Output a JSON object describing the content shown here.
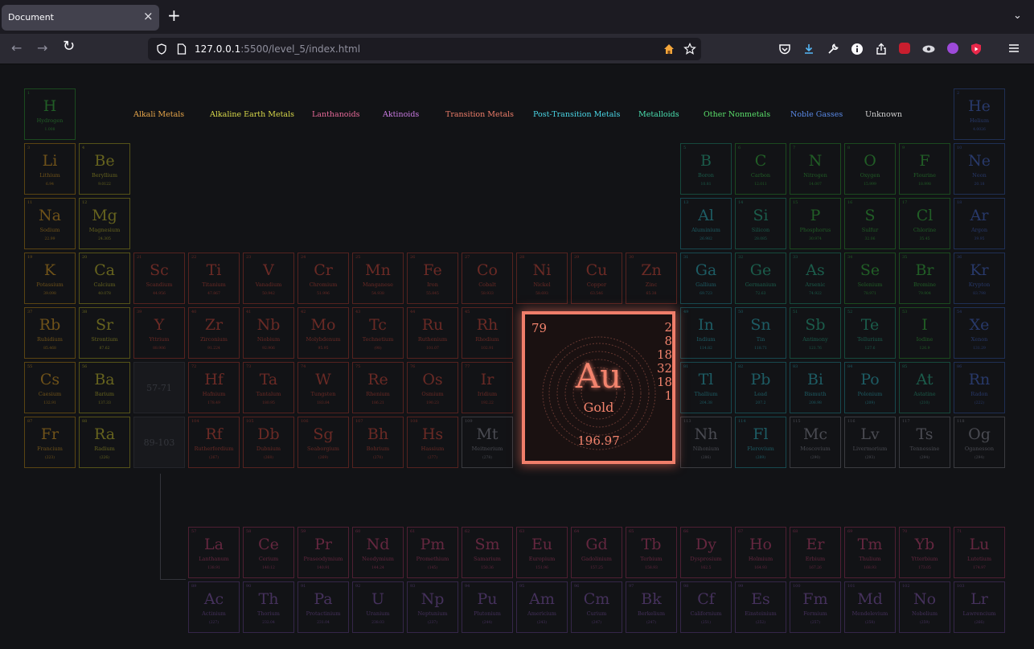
{
  "browser": {
    "tab_title": "Document",
    "tab_close": "×",
    "new_tab": "+",
    "tabs_menu": "⌄",
    "url_host": "127.0.0.1",
    "url_path": ":5500/level_5/index.html",
    "nav": {
      "back": "←",
      "forward": "→",
      "reload": "↻"
    }
  },
  "legend": [
    {
      "label": "Alkali Metals",
      "color": "#e8a64a"
    },
    {
      "label": "Alkaline Earth Metals",
      "color": "#d9d94a"
    },
    {
      "label": "Lanthanoids",
      "color": "#e86a9a"
    },
    {
      "label": "Aktinoids",
      "color": "#c87ae0"
    },
    {
      "label": "Transition Metals",
      "color": "#f07e6a"
    },
    {
      "label": "Post-Transition Metals",
      "color": "#4ad8e8"
    },
    {
      "label": "Metalloids",
      "color": "#4ae0b0"
    },
    {
      "label": "Other Nonmetals",
      "color": "#5ae06a"
    },
    {
      "label": "Noble Gasses",
      "color": "#5a8ae8"
    },
    {
      "label": "Unknown",
      "color": "#cfcfcf"
    }
  ],
  "categories": {
    "alkali": {
      "border": "#5a4412",
      "text": "#6f5219"
    },
    "alkaline": {
      "border": "#555218",
      "text": "#66631e"
    },
    "transition": {
      "border": "#55221f",
      "text": "#6a2a25"
    },
    "post": {
      "border": "#17484e",
      "text": "#1d5c64"
    },
    "metalloid": {
      "border": "#16493c",
      "text": "#1b5c4b"
    },
    "nonmetal": {
      "border": "#1b4a1f",
      "text": "#215e26"
    },
    "noble": {
      "border": "#1f2f54",
      "text": "#28396a"
    },
    "unknown": {
      "border": "#3a3b40",
      "text": "#4a4b52"
    },
    "lanth": {
      "border": "#4e1f33",
      "text": "#64273f"
    },
    "act": {
      "border": "#352648",
      "text": "#45315c"
    }
  },
  "elements": [
    {
      "n": "1",
      "s": "H",
      "name": "Hydrogen",
      "w": "1.008",
      "c": "nonmetal",
      "r": 1,
      "col": 1
    },
    {
      "n": "2",
      "s": "He",
      "name": "Helium",
      "w": "4.0026",
      "c": "noble",
      "r": 1,
      "col": 18
    },
    {
      "n": "3",
      "s": "Li",
      "name": "Lithium",
      "w": "6.94",
      "c": "alkali",
      "r": 2,
      "col": 1
    },
    {
      "n": "4",
      "s": "Be",
      "name": "Beryllium",
      "w": "9.0122",
      "c": "alkaline",
      "r": 2,
      "col": 2
    },
    {
      "n": "5",
      "s": "B",
      "name": "Boron",
      "w": "10.81",
      "c": "metalloid",
      "r": 2,
      "col": 13
    },
    {
      "n": "6",
      "s": "C",
      "name": "Carbon",
      "w": "12.011",
      "c": "nonmetal",
      "r": 2,
      "col": 14
    },
    {
      "n": "7",
      "s": "N",
      "name": "Nitrogen",
      "w": "14.007",
      "c": "nonmetal",
      "r": 2,
      "col": 15
    },
    {
      "n": "8",
      "s": "O",
      "name": "Oxygen",
      "w": "15.999",
      "c": "nonmetal",
      "r": 2,
      "col": 16
    },
    {
      "n": "9",
      "s": "F",
      "name": "Flourine",
      "w": "18.998",
      "c": "nonmetal",
      "r": 2,
      "col": 17
    },
    {
      "n": "10",
      "s": "Ne",
      "name": "Neon",
      "w": "20.18",
      "c": "noble",
      "r": 2,
      "col": 18
    },
    {
      "n": "11",
      "s": "Na",
      "name": "Sodium",
      "w": "22.99",
      "c": "alkali",
      "r": 3,
      "col": 1
    },
    {
      "n": "12",
      "s": "Mg",
      "name": "Magnesium",
      "w": "24.305",
      "c": "alkaline",
      "r": 3,
      "col": 2
    },
    {
      "n": "13",
      "s": "Al",
      "name": "Aluminium",
      "w": "26.982",
      "c": "post",
      "r": 3,
      "col": 13
    },
    {
      "n": "14",
      "s": "Si",
      "name": "Silicon",
      "w": "28.085",
      "c": "metalloid",
      "r": 3,
      "col": 14
    },
    {
      "n": "15",
      "s": "P",
      "name": "Phosphorus",
      "w": "30.974",
      "c": "nonmetal",
      "r": 3,
      "col": 15
    },
    {
      "n": "16",
      "s": "S",
      "name": "Sulfur",
      "w": "32.06",
      "c": "nonmetal",
      "r": 3,
      "col": 16
    },
    {
      "n": "17",
      "s": "Cl",
      "name": "Chlorine",
      "w": "35.45",
      "c": "nonmetal",
      "r": 3,
      "col": 17
    },
    {
      "n": "18",
      "s": "Ar",
      "name": "Argon",
      "w": "39.95",
      "c": "noble",
      "r": 3,
      "col": 18
    },
    {
      "n": "19",
      "s": "K",
      "name": "Potassium",
      "w": "39.098",
      "c": "alkali",
      "r": 4,
      "col": 1
    },
    {
      "n": "20",
      "s": "Ca",
      "name": "Calcium",
      "w": "40.078",
      "c": "alkaline",
      "r": 4,
      "col": 2
    },
    {
      "n": "21",
      "s": "Sc",
      "name": "Scandium",
      "w": "44.956",
      "c": "transition",
      "r": 4,
      "col": 3
    },
    {
      "n": "22",
      "s": "Ti",
      "name": "Titanium",
      "w": "47.867",
      "c": "transition",
      "r": 4,
      "col": 4
    },
    {
      "n": "23",
      "s": "V",
      "name": "Vanadium",
      "w": "50.942",
      "c": "transition",
      "r": 4,
      "col": 5
    },
    {
      "n": "24",
      "s": "Cr",
      "name": "Chromium",
      "w": "51.996",
      "c": "transition",
      "r": 4,
      "col": 6
    },
    {
      "n": "25",
      "s": "Mn",
      "name": "Manganese",
      "w": "54.938",
      "c": "transition",
      "r": 4,
      "col": 7
    },
    {
      "n": "26",
      "s": "Fe",
      "name": "Iron",
      "w": "55.845",
      "c": "transition",
      "r": 4,
      "col": 8
    },
    {
      "n": "27",
      "s": "Co",
      "name": "Cobalt",
      "w": "58.933",
      "c": "transition",
      "r": 4,
      "col": 9
    },
    {
      "n": "28",
      "s": "Ni",
      "name": "Nickel",
      "w": "58.693",
      "c": "transition",
      "r": 4,
      "col": 10
    },
    {
      "n": "29",
      "s": "Cu",
      "name": "Copper",
      "w": "63.546",
      "c": "transition",
      "r": 4,
      "col": 11
    },
    {
      "n": "30",
      "s": "Zn",
      "name": "Zinc",
      "w": "65.38",
      "c": "transition",
      "r": 4,
      "col": 12
    },
    {
      "n": "31",
      "s": "Ga",
      "name": "Gallium",
      "w": "69.723",
      "c": "post",
      "r": 4,
      "col": 13
    },
    {
      "n": "32",
      "s": "Ge",
      "name": "Germanium",
      "w": "72.63",
      "c": "metalloid",
      "r": 4,
      "col": 14
    },
    {
      "n": "33",
      "s": "As",
      "name": "Arsenic",
      "w": "74.922",
      "c": "metalloid",
      "r": 4,
      "col": 15
    },
    {
      "n": "34",
      "s": "Se",
      "name": "Selenium",
      "w": "78.971",
      "c": "nonmetal",
      "r": 4,
      "col": 16
    },
    {
      "n": "35",
      "s": "Br",
      "name": "Bromine",
      "w": "79.904",
      "c": "nonmetal",
      "r": 4,
      "col": 17
    },
    {
      "n": "36",
      "s": "Kr",
      "name": "Krypton",
      "w": "83.798",
      "c": "noble",
      "r": 4,
      "col": 18
    },
    {
      "n": "37",
      "s": "Rb",
      "name": "Rubidium",
      "w": "85.468",
      "c": "alkali",
      "r": 5,
      "col": 1
    },
    {
      "n": "38",
      "s": "Sr",
      "name": "Strontium",
      "w": "87.62",
      "c": "alkaline",
      "r": 5,
      "col": 2
    },
    {
      "n": "39",
      "s": "Y",
      "name": "Yttrium",
      "w": "88.906",
      "c": "transition",
      "r": 5,
      "col": 3
    },
    {
      "n": "40",
      "s": "Zr",
      "name": "Zirconium",
      "w": "91.224",
      "c": "transition",
      "r": 5,
      "col": 4
    },
    {
      "n": "41",
      "s": "Nb",
      "name": "Niobium",
      "w": "92.906",
      "c": "transition",
      "r": 5,
      "col": 5
    },
    {
      "n": "42",
      "s": "Mo",
      "name": "Molybdenum",
      "w": "95.95",
      "c": "transition",
      "r": 5,
      "col": 6
    },
    {
      "n": "43",
      "s": "Tc",
      "name": "Technetium",
      "w": "(98)",
      "c": "transition",
      "r": 5,
      "col": 7
    },
    {
      "n": "44",
      "s": "Ru",
      "name": "Ruthenium",
      "w": "101.07",
      "c": "transition",
      "r": 5,
      "col": 8
    },
    {
      "n": "45",
      "s": "Rh",
      "name": "Rhodium",
      "w": "102.91",
      "c": "transition",
      "r": 5,
      "col": 9
    },
    {
      "n": "49",
      "s": "In",
      "name": "Indium",
      "w": "114.82",
      "c": "post",
      "r": 5,
      "col": 13
    },
    {
      "n": "50",
      "s": "Sn",
      "name": "Tin",
      "w": "118.71",
      "c": "post",
      "r": 5,
      "col": 14
    },
    {
      "n": "51",
      "s": "Sb",
      "name": "Antimony",
      "w": "121.76",
      "c": "metalloid",
      "r": 5,
      "col": 15
    },
    {
      "n": "52",
      "s": "Te",
      "name": "Tellurium",
      "w": "127.6",
      "c": "metalloid",
      "r": 5,
      "col": 16
    },
    {
      "n": "53",
      "s": "I",
      "name": "Iodine",
      "w": "126.9",
      "c": "nonmetal",
      "r": 5,
      "col": 17
    },
    {
      "n": "54",
      "s": "Xe",
      "name": "Xenon",
      "w": "131.29",
      "c": "noble",
      "r": 5,
      "col": 18
    },
    {
      "n": "55",
      "s": "Cs",
      "name": "Caesium",
      "w": "132.91",
      "c": "alkali",
      "r": 6,
      "col": 1
    },
    {
      "n": "56",
      "s": "Ba",
      "name": "Barium",
      "w": "137.33",
      "c": "alkaline",
      "r": 6,
      "col": 2
    },
    {
      "n": "72",
      "s": "Hf",
      "name": "Hafnium",
      "w": "178.49",
      "c": "transition",
      "r": 6,
      "col": 4
    },
    {
      "n": "73",
      "s": "Ta",
      "name": "Tantalum",
      "w": "180.95",
      "c": "transition",
      "r": 6,
      "col": 5
    },
    {
      "n": "74",
      "s": "W",
      "name": "Tungsten",
      "w": "183.84",
      "c": "transition",
      "r": 6,
      "col": 6
    },
    {
      "n": "75",
      "s": "Re",
      "name": "Rhenium",
      "w": "186.21",
      "c": "transition",
      "r": 6,
      "col": 7
    },
    {
      "n": "76",
      "s": "Os",
      "name": "Osmium",
      "w": "190.23",
      "c": "transition",
      "r": 6,
      "col": 8
    },
    {
      "n": "77",
      "s": "Ir",
      "name": "Iridium",
      "w": "192.22",
      "c": "transition",
      "r": 6,
      "col": 9
    },
    {
      "n": "81",
      "s": "Tl",
      "name": "Thallium",
      "w": "204.38",
      "c": "post",
      "r": 6,
      "col": 13
    },
    {
      "n": "82",
      "s": "Pb",
      "name": "Lead",
      "w": "207.2",
      "c": "post",
      "r": 6,
      "col": 14
    },
    {
      "n": "83",
      "s": "Bi",
      "name": "Bismuth",
      "w": "208.98",
      "c": "post",
      "r": 6,
      "col": 15
    },
    {
      "n": "84",
      "s": "Po",
      "name": "Polonium",
      "w": "(209)",
      "c": "post",
      "r": 6,
      "col": 16
    },
    {
      "n": "85",
      "s": "At",
      "name": "Astatine",
      "w": "(210)",
      "c": "metalloid",
      "r": 6,
      "col": 17
    },
    {
      "n": "86",
      "s": "Rn",
      "name": "Radon",
      "w": "(222)",
      "c": "noble",
      "r": 6,
      "col": 18
    },
    {
      "n": "87",
      "s": "Fr",
      "name": "Francium",
      "w": "(223)",
      "c": "alkali",
      "r": 7,
      "col": 1
    },
    {
      "n": "88",
      "s": "Ra",
      "name": "Radium",
      "w": "(226)",
      "c": "alkaline",
      "r": 7,
      "col": 2
    },
    {
      "n": "104",
      "s": "Rf",
      "name": "Rutherfordium",
      "w": "(267)",
      "c": "transition",
      "r": 7,
      "col": 4
    },
    {
      "n": "105",
      "s": "Db",
      "name": "Dubnium",
      "w": "(268)",
      "c": "transition",
      "r": 7,
      "col": 5
    },
    {
      "n": "106",
      "s": "Sg",
      "name": "Seaborgium",
      "w": "(269)",
      "c": "transition",
      "r": 7,
      "col": 6
    },
    {
      "n": "107",
      "s": "Bh",
      "name": "Bohrium",
      "w": "(270)",
      "c": "transition",
      "r": 7,
      "col": 7
    },
    {
      "n": "108",
      "s": "Hs",
      "name": "Hassium",
      "w": "(277)",
      "c": "transition",
      "r": 7,
      "col": 8
    },
    {
      "n": "109",
      "s": "Mt",
      "name": "Meitnerium",
      "w": "(278)",
      "c": "unknown",
      "r": 7,
      "col": 9
    },
    {
      "n": "113",
      "s": "Nh",
      "name": "Nihonium",
      "w": "(286)",
      "c": "unknown",
      "r": 7,
      "col": 13
    },
    {
      "n": "114",
      "s": "Fl",
      "name": "Flerovium",
      "w": "(289)",
      "c": "post",
      "r": 7,
      "col": 14
    },
    {
      "n": "115",
      "s": "Mc",
      "name": "Moscovium",
      "w": "(290)",
      "c": "unknown",
      "r": 7,
      "col": 15
    },
    {
      "n": "116",
      "s": "Lv",
      "name": "Livermorium",
      "w": "(293)",
      "c": "unknown",
      "r": 7,
      "col": 16
    },
    {
      "n": "117",
      "s": "Ts",
      "name": "Tennessine",
      "w": "(294)",
      "c": "unknown",
      "r": 7,
      "col": 17
    },
    {
      "n": "118",
      "s": "Og",
      "name": "Oganesson",
      "w": "(294)",
      "c": "unknown",
      "r": 7,
      "col": 18
    },
    {
      "n": "57",
      "s": "La",
      "name": "Lanthanum",
      "w": "138.91",
      "c": "lanth",
      "r": 9,
      "col": 4
    },
    {
      "n": "58",
      "s": "Ce",
      "name": "Cerium",
      "w": "140.12",
      "c": "lanth",
      "r": 9,
      "col": 5
    },
    {
      "n": "59",
      "s": "Pr",
      "name": "Praseodymium",
      "w": "140.91",
      "c": "lanth",
      "r": 9,
      "col": 6
    },
    {
      "n": "60",
      "s": "Nd",
      "name": "Neodymium",
      "w": "144.24",
      "c": "lanth",
      "r": 9,
      "col": 7
    },
    {
      "n": "61",
      "s": "Pm",
      "name": "Promethium",
      "w": "(145)",
      "c": "lanth",
      "r": 9,
      "col": 8
    },
    {
      "n": "62",
      "s": "Sm",
      "name": "Samarium",
      "w": "150.36",
      "c": "lanth",
      "r": 9,
      "col": 9
    },
    {
      "n": "63",
      "s": "Eu",
      "name": "Europium",
      "w": "151.96",
      "c": "lanth",
      "r": 9,
      "col": 10
    },
    {
      "n": "64",
      "s": "Gd",
      "name": "Gadolinium",
      "w": "157.25",
      "c": "lanth",
      "r": 9,
      "col": 11
    },
    {
      "n": "65",
      "s": "Tb",
      "name": "Terbium",
      "w": "158.93",
      "c": "lanth",
      "r": 9,
      "col": 12
    },
    {
      "n": "66",
      "s": "Dy",
      "name": "Dysprosium",
      "w": "162.5",
      "c": "lanth",
      "r": 9,
      "col": 13
    },
    {
      "n": "67",
      "s": "Ho",
      "name": "Holmium",
      "w": "164.93",
      "c": "lanth",
      "r": 9,
      "col": 14
    },
    {
      "n": "68",
      "s": "Er",
      "name": "Erbium",
      "w": "167.26",
      "c": "lanth",
      "r": 9,
      "col": 15
    },
    {
      "n": "69",
      "s": "Tm",
      "name": "Thulium",
      "w": "168.93",
      "c": "lanth",
      "r": 9,
      "col": 16
    },
    {
      "n": "70",
      "s": "Yb",
      "name": "Ytterbium",
      "w": "173.05",
      "c": "lanth",
      "r": 9,
      "col": 17
    },
    {
      "n": "71",
      "s": "Lu",
      "name": "Lutetium",
      "w": "174.97",
      "c": "lanth",
      "r": 9,
      "col": 18
    },
    {
      "n": "89",
      "s": "Ac",
      "name": "Actinium",
      "w": "(227)",
      "c": "act",
      "r": 10,
      "col": 4
    },
    {
      "n": "90",
      "s": "Th",
      "name": "Thorium",
      "w": "232.04",
      "c": "act",
      "r": 10,
      "col": 5
    },
    {
      "n": "91",
      "s": "Pa",
      "name": "Protactinium",
      "w": "231.04",
      "c": "act",
      "r": 10,
      "col": 6
    },
    {
      "n": "92",
      "s": "U",
      "name": "Uranium",
      "w": "238.03",
      "c": "act",
      "r": 10,
      "col": 7
    },
    {
      "n": "93",
      "s": "Np",
      "name": "Neptunium",
      "w": "(237)",
      "c": "act",
      "r": 10,
      "col": 8
    },
    {
      "n": "94",
      "s": "Pu",
      "name": "Plutonium",
      "w": "(244)",
      "c": "act",
      "r": 10,
      "col": 9
    },
    {
      "n": "95",
      "s": "Am",
      "name": "Americium",
      "w": "(243)",
      "c": "act",
      "r": 10,
      "col": 10
    },
    {
      "n": "96",
      "s": "Cm",
      "name": "Curium",
      "w": "(247)",
      "c": "act",
      "r": 10,
      "col": 11
    },
    {
      "n": "97",
      "s": "Bk",
      "name": "Berkelium",
      "w": "(247)",
      "c": "act",
      "r": 10,
      "col": 12
    },
    {
      "n": "98",
      "s": "Cf",
      "name": "Californium",
      "w": "(251)",
      "c": "act",
      "r": 10,
      "col": 13
    },
    {
      "n": "99",
      "s": "Es",
      "name": "Einsteinium",
      "w": "(252)",
      "c": "act",
      "r": 10,
      "col": 14
    },
    {
      "n": "100",
      "s": "Fm",
      "name": "Fermium",
      "w": "(257)",
      "c": "act",
      "r": 10,
      "col": 15
    },
    {
      "n": "101",
      "s": "Md",
      "name": "Mendelevium",
      "w": "(258)",
      "c": "act",
      "r": 10,
      "col": 16
    },
    {
      "n": "102",
      "s": "No",
      "name": "Nobelium",
      "w": "(259)",
      "c": "act",
      "r": 10,
      "col": 17
    },
    {
      "n": "103",
      "s": "Lr",
      "name": "Lawrencium",
      "w": "(266)",
      "c": "act",
      "r": 10,
      "col": 18
    }
  ],
  "placeholders": [
    {
      "label": "57-71",
      "r": 6,
      "col": 3
    },
    {
      "label": "89-103",
      "r": 7,
      "col": 3
    }
  ],
  "selected": {
    "number": "79",
    "symbol": "Au",
    "name": "Gold",
    "weight": "196.97",
    "shells": [
      "2",
      "8",
      "18",
      "32",
      "18",
      "1"
    ]
  }
}
